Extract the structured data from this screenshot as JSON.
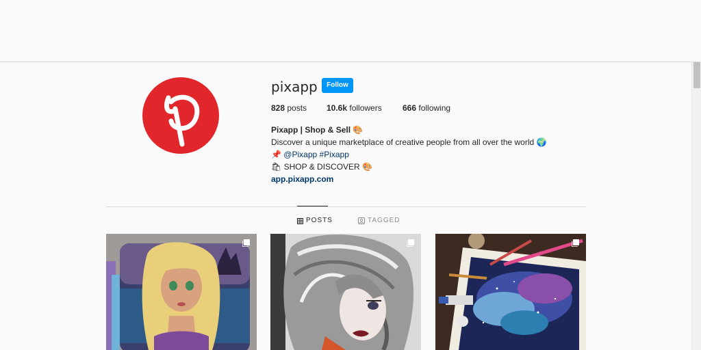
{
  "profile": {
    "username": "pixapp",
    "follow_label": "Follow",
    "stats": {
      "posts_count": "828",
      "posts_label": "posts",
      "followers_count": "10.6k",
      "followers_label": "followers",
      "following_count": "666",
      "following_label": "following"
    },
    "bio": {
      "name": "Pixapp | Shop & Sell 🎨",
      "line1": "Discover a unique marketplace of creative people from all over the world 🌍",
      "pin": "📌",
      "mention": "@Pixapp",
      "hashtag": "#Pixapp",
      "line3": "🛍 SHOP & DISCOVER 🎨",
      "website": "app.pixapp.com"
    }
  },
  "tabs": [
    {
      "label": "POSTS",
      "icon": "grid-icon",
      "active": true
    },
    {
      "label": "TAGGED",
      "icon": "tagged-icon",
      "active": false
    }
  ],
  "posts": [
    {
      "subject": "blonde-girl-drawing",
      "icon": "multiple-images-icon"
    },
    {
      "subject": "silver-hair-girl-drawing",
      "icon": "multiple-images-icon"
    },
    {
      "subject": "galaxy-painting",
      "icon": "multiple-images-icon"
    }
  ],
  "colors": {
    "brand_red": "#e1262c",
    "follow_blue": "#0095f6",
    "link_blue": "#00376b"
  }
}
